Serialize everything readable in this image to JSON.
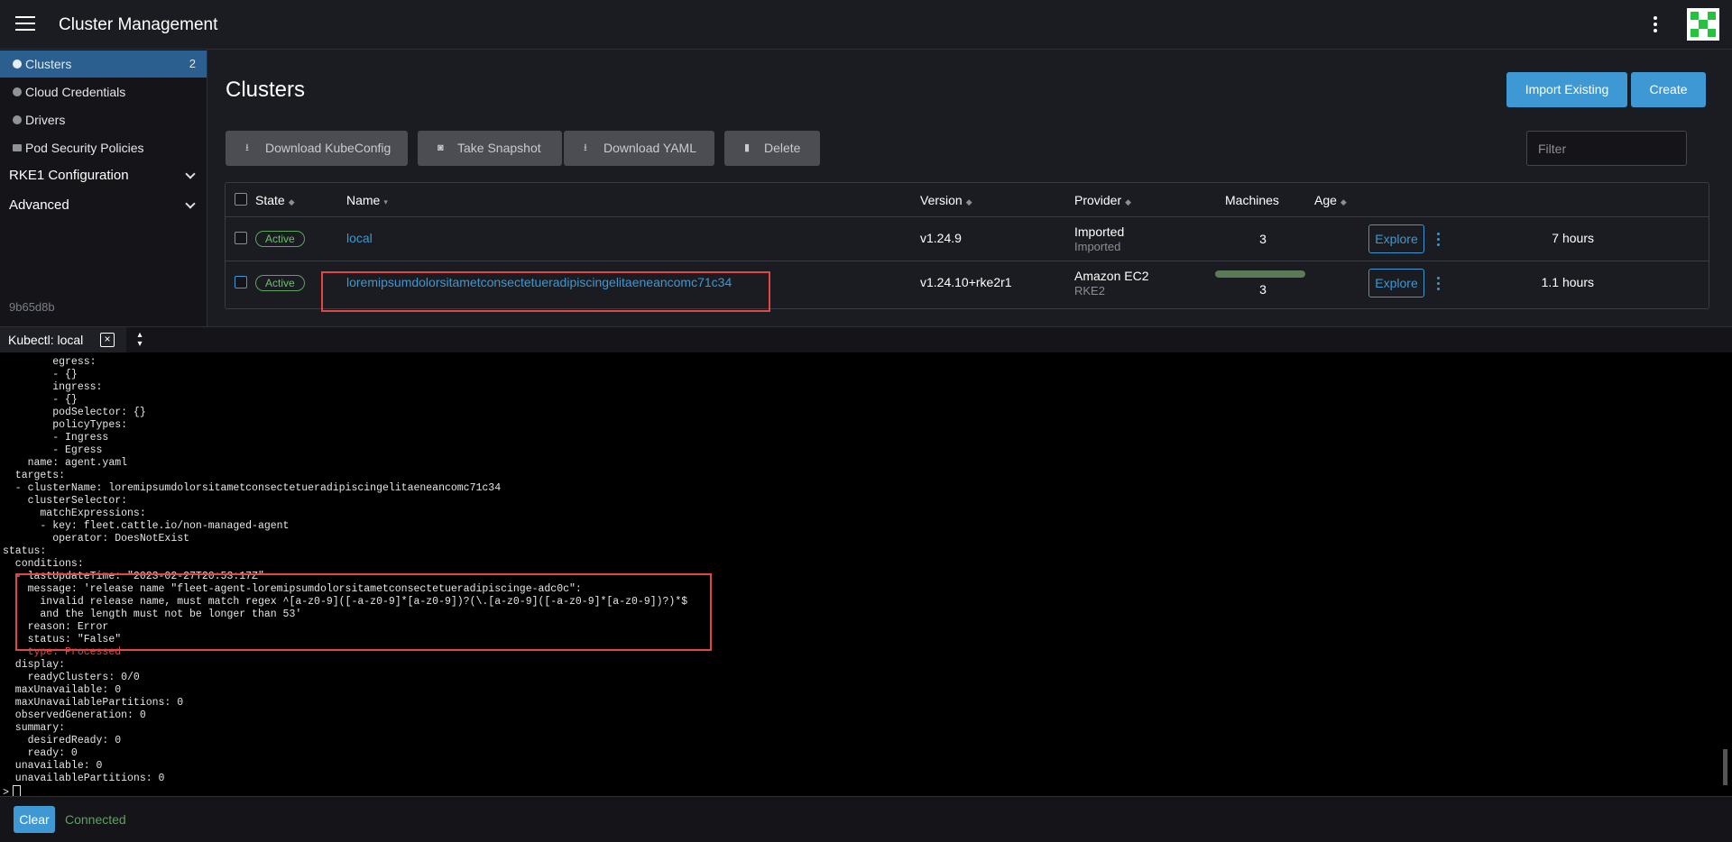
{
  "header": {
    "title": "Cluster Management"
  },
  "sidebar": {
    "items": [
      {
        "label": "Clusters",
        "count": "2"
      },
      {
        "label": "Cloud Credentials"
      },
      {
        "label": "Drivers"
      },
      {
        "label": "Pod Security Policies"
      }
    ],
    "groups": [
      {
        "label": "RKE1 Configuration"
      },
      {
        "label": "Advanced"
      }
    ],
    "version": "9b65d8b"
  },
  "main": {
    "title": "Clusters",
    "import_label": "Import Existing",
    "create_label": "Create",
    "actions": {
      "download_kubeconfig": "Download KubeConfig",
      "take_snapshot": "Take Snapshot",
      "download_yaml": "Download YAML",
      "delete": "Delete"
    },
    "filter_placeholder": "Filter",
    "table": {
      "columns": [
        "State",
        "Name",
        "Version",
        "Provider",
        "Machines",
        "Age"
      ],
      "rows": [
        {
          "state": "Active",
          "name": "local",
          "version": "v1.24.9",
          "provider": "Imported",
          "provider_sub": "Imported",
          "machines": "3",
          "age": "7 hours",
          "explore": "Explore"
        },
        {
          "state": "Active",
          "name": "loremipsumdolorsitametconsectetueradipiscingelitaeneancomc71c34",
          "version": "v1.24.10+rke2r1",
          "provider": "Amazon EC2",
          "provider_sub": "RKE2",
          "machines": "3",
          "age": "1.1 hours",
          "explore": "Explore"
        }
      ]
    }
  },
  "kubectl": {
    "tab_label": "Kubectl: local",
    "lines": [
      "        egress:",
      "        - {}",
      "        ingress:",
      "        - {}",
      "        podSelector: {}",
      "        policyTypes:",
      "        - Ingress",
      "        - Egress",
      "    name: agent.yaml",
      "  targets:",
      "  - clusterName: loremipsumdolorsitametconsectetueradipiscingelitaeneancomc71c34",
      "    clusterSelector:",
      "      matchExpressions:",
      "      - key: fleet.cattle.io/non-managed-agent",
      "        operator: DoesNotExist",
      "status:",
      "  conditions:",
      "  - lastUpdateTime: \"2023-02-27T20:53:17Z\"",
      "    message: 'release name \"fleet-agent-loremipsumdolorsitametconsectetueradipiscinge-adc0c\":",
      "      invalid release name, must match regex ^[a-z0-9]([-a-z0-9]*[a-z0-9])?(\\.[a-z0-9]([-a-z0-9]*[a-z0-9])?)*$",
      "      and the length must not be longer than 53'",
      "    reason: Error",
      "    status: \"False\"",
      "    type: Processed",
      "  display:",
      "    readyClusters: 0/0",
      "  maxUnavailable: 0",
      "  maxUnavailablePartitions: 0",
      "  observedGeneration: 0",
      "  summary:",
      "    desiredReady: 0",
      "    ready: 0",
      "  unavailable: 0",
      "  unavailablePartitions: 0"
    ],
    "prompt": ">",
    "clear_label": "Clear",
    "status": "Connected"
  },
  "colors": {
    "accent": "#3d98d3",
    "active": "#5aa55a",
    "highlight": "#e04848"
  }
}
